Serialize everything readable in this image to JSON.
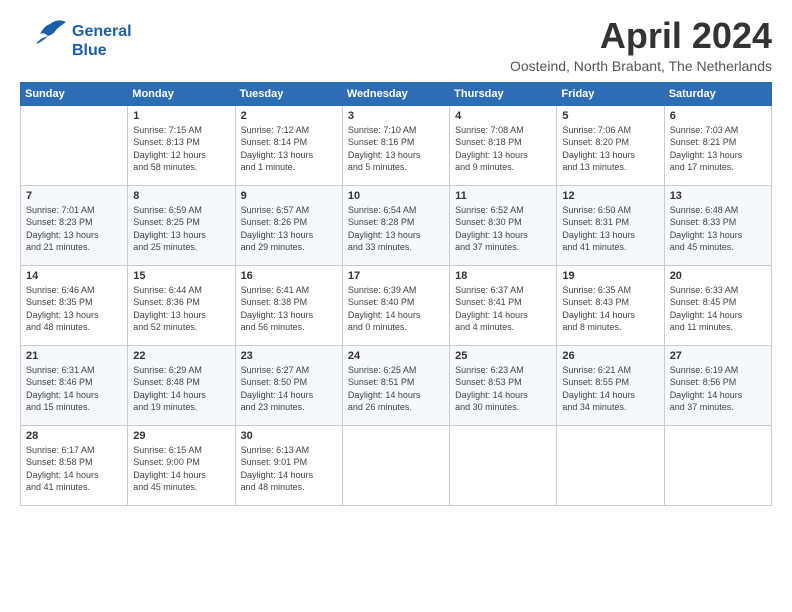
{
  "logo": {
    "line1": "General",
    "line2": "Blue"
  },
  "title": "April 2024",
  "subtitle": "Oosteind, North Brabant, The Netherlands",
  "days_header": [
    "Sunday",
    "Monday",
    "Tuesday",
    "Wednesday",
    "Thursday",
    "Friday",
    "Saturday"
  ],
  "weeks": [
    [
      {
        "num": "",
        "info": ""
      },
      {
        "num": "1",
        "info": "Sunrise: 7:15 AM\nSunset: 8:13 PM\nDaylight: 12 hours\nand 58 minutes."
      },
      {
        "num": "2",
        "info": "Sunrise: 7:12 AM\nSunset: 8:14 PM\nDaylight: 13 hours\nand 1 minute."
      },
      {
        "num": "3",
        "info": "Sunrise: 7:10 AM\nSunset: 8:16 PM\nDaylight: 13 hours\nand 5 minutes."
      },
      {
        "num": "4",
        "info": "Sunrise: 7:08 AM\nSunset: 8:18 PM\nDaylight: 13 hours\nand 9 minutes."
      },
      {
        "num": "5",
        "info": "Sunrise: 7:06 AM\nSunset: 8:20 PM\nDaylight: 13 hours\nand 13 minutes."
      },
      {
        "num": "6",
        "info": "Sunrise: 7:03 AM\nSunset: 8:21 PM\nDaylight: 13 hours\nand 17 minutes."
      }
    ],
    [
      {
        "num": "7",
        "info": "Sunrise: 7:01 AM\nSunset: 8:23 PM\nDaylight: 13 hours\nand 21 minutes."
      },
      {
        "num": "8",
        "info": "Sunrise: 6:59 AM\nSunset: 8:25 PM\nDaylight: 13 hours\nand 25 minutes."
      },
      {
        "num": "9",
        "info": "Sunrise: 6:57 AM\nSunset: 8:26 PM\nDaylight: 13 hours\nand 29 minutes."
      },
      {
        "num": "10",
        "info": "Sunrise: 6:54 AM\nSunset: 8:28 PM\nDaylight: 13 hours\nand 33 minutes."
      },
      {
        "num": "11",
        "info": "Sunrise: 6:52 AM\nSunset: 8:30 PM\nDaylight: 13 hours\nand 37 minutes."
      },
      {
        "num": "12",
        "info": "Sunrise: 6:50 AM\nSunset: 8:31 PM\nDaylight: 13 hours\nand 41 minutes."
      },
      {
        "num": "13",
        "info": "Sunrise: 6:48 AM\nSunset: 8:33 PM\nDaylight: 13 hours\nand 45 minutes."
      }
    ],
    [
      {
        "num": "14",
        "info": "Sunrise: 6:46 AM\nSunset: 8:35 PM\nDaylight: 13 hours\nand 48 minutes."
      },
      {
        "num": "15",
        "info": "Sunrise: 6:44 AM\nSunset: 8:36 PM\nDaylight: 13 hours\nand 52 minutes."
      },
      {
        "num": "16",
        "info": "Sunrise: 6:41 AM\nSunset: 8:38 PM\nDaylight: 13 hours\nand 56 minutes."
      },
      {
        "num": "17",
        "info": "Sunrise: 6:39 AM\nSunset: 8:40 PM\nDaylight: 14 hours\nand 0 minutes."
      },
      {
        "num": "18",
        "info": "Sunrise: 6:37 AM\nSunset: 8:41 PM\nDaylight: 14 hours\nand 4 minutes."
      },
      {
        "num": "19",
        "info": "Sunrise: 6:35 AM\nSunset: 8:43 PM\nDaylight: 14 hours\nand 8 minutes."
      },
      {
        "num": "20",
        "info": "Sunrise: 6:33 AM\nSunset: 8:45 PM\nDaylight: 14 hours\nand 11 minutes."
      }
    ],
    [
      {
        "num": "21",
        "info": "Sunrise: 6:31 AM\nSunset: 8:46 PM\nDaylight: 14 hours\nand 15 minutes."
      },
      {
        "num": "22",
        "info": "Sunrise: 6:29 AM\nSunset: 8:48 PM\nDaylight: 14 hours\nand 19 minutes."
      },
      {
        "num": "23",
        "info": "Sunrise: 6:27 AM\nSunset: 8:50 PM\nDaylight: 14 hours\nand 23 minutes."
      },
      {
        "num": "24",
        "info": "Sunrise: 6:25 AM\nSunset: 8:51 PM\nDaylight: 14 hours\nand 26 minutes."
      },
      {
        "num": "25",
        "info": "Sunrise: 6:23 AM\nSunset: 8:53 PM\nDaylight: 14 hours\nand 30 minutes."
      },
      {
        "num": "26",
        "info": "Sunrise: 6:21 AM\nSunset: 8:55 PM\nDaylight: 14 hours\nand 34 minutes."
      },
      {
        "num": "27",
        "info": "Sunrise: 6:19 AM\nSunset: 8:56 PM\nDaylight: 14 hours\nand 37 minutes."
      }
    ],
    [
      {
        "num": "28",
        "info": "Sunrise: 6:17 AM\nSunset: 8:58 PM\nDaylight: 14 hours\nand 41 minutes."
      },
      {
        "num": "29",
        "info": "Sunrise: 6:15 AM\nSunset: 9:00 PM\nDaylight: 14 hours\nand 45 minutes."
      },
      {
        "num": "30",
        "info": "Sunrise: 6:13 AM\nSunset: 9:01 PM\nDaylight: 14 hours\nand 48 minutes."
      },
      {
        "num": "",
        "info": ""
      },
      {
        "num": "",
        "info": ""
      },
      {
        "num": "",
        "info": ""
      },
      {
        "num": "",
        "info": ""
      }
    ]
  ]
}
